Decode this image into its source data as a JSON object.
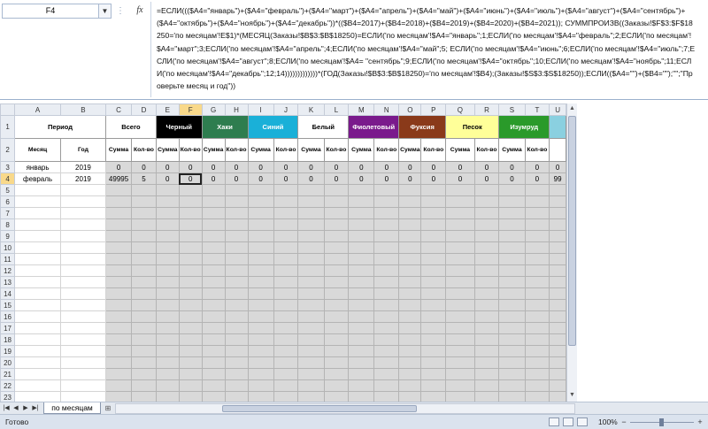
{
  "formula_bar": {
    "name_box": "F4",
    "fx_label": "fx",
    "formula": "=ЕСЛИ((($A4=\"январь\")+($A4=\"февраль\")+($A4=\"март\")+($A4=\"апрель\")+($A4=\"май\")+($A4=\"июнь\")+($A4=\"июль\")+($A4=\"август\")+($A4=\"сентябрь\")+($A4=\"октябрь\")+($A4=\"ноябрь\")+($A4=\"декабрь\"))*(($B4=2017)+($B4=2018)+($B4=2019)+($B4=2020)+($B4=2021)); СУММПРОИЗВ((Заказы!$F$3:$F$18250='по месяцам'!E$1)*(МЕСЯЦ(Заказы!$B$3:$B$18250)=ЕСЛИ('по месяцам'!$A4=\"январь\";1;ЕСЛИ('по месяцам'!$A4=\"февраль\";2;ЕСЛИ('по месяцам'!$A4=\"март\";3;ЕСЛИ('по месяцам'!$A4=\"апрель\";4;ЕСЛИ('по месяцам'!$A4=\"май\";5; ЕСЛИ('по месяцам'!$A4=\"июнь\";6;ЕСЛИ('по месяцам'!$A4=\"июль\";7;ЕСЛИ('по месяцам'!$A4=\"август\";8;ЕСЛИ('по месяцам'!$A4= \"сентябрь\";9;ЕСЛИ('по месяцам'!$A4=\"октябрь\";10;ЕСЛИ('по месяцам'!$A4=\"ноябрь\";11;ЕСЛИ('по месяцам'!$A4=\"декабрь\";12;14)))))))))))))*(ГОД(Заказы!$B$3:$B$18250)='по месяцам'!$B4);(Заказы!$S$3:$S$18250));ЕСЛИ(($A4=\"\")+($B4=\"\");\"\";\"Проверьте месяц и год\"))"
  },
  "columns": [
    "A",
    "B",
    "C",
    "D",
    "E",
    "F",
    "G",
    "H",
    "I",
    "J",
    "K",
    "L",
    "M",
    "N",
    "O",
    "P",
    "Q",
    "R",
    "S",
    "T",
    "U"
  ],
  "header_row1": {
    "period": "Период",
    "total": "Всего",
    "colors": [
      {
        "name": "Черный",
        "bg": "#000000",
        "fg": "#ffffff"
      },
      {
        "name": "Хаки",
        "bg": "#2e7d4f",
        "fg": "#ffffff"
      },
      {
        "name": "Синий",
        "bg": "#1ab0d8",
        "fg": "#ffffff"
      },
      {
        "name": "Белый",
        "bg": "#ffffff",
        "fg": "#000000"
      },
      {
        "name": "Фиолетовый",
        "bg": "#7a1a8c",
        "fg": "#ffffff"
      },
      {
        "name": "Фуксия",
        "bg": "#8a3a1a",
        "fg": "#ffffff"
      },
      {
        "name": "Песок",
        "bg": "#ffff99",
        "fg": "#000000"
      },
      {
        "name": "Изумруд",
        "bg": "#2a9a2a",
        "fg": "#ffffff"
      }
    ]
  },
  "header_row2": {
    "month": "Месяц",
    "year": "Год",
    "sum": "Сумма",
    "qty": "Кол-во"
  },
  "rows": [
    {
      "num": "3",
      "month": "январь",
      "year": "2019",
      "values": [
        "0",
        "0",
        "0",
        "0",
        "0",
        "0",
        "0",
        "0",
        "0",
        "0",
        "0",
        "0",
        "0",
        "0",
        "0",
        "0",
        "0",
        "0",
        "0"
      ]
    },
    {
      "num": "4",
      "month": "февраль",
      "year": "2019",
      "values": [
        "49995",
        "5",
        "0",
        "0",
        "0",
        "0",
        "0",
        "0",
        "0",
        "0",
        "0",
        "0",
        "0",
        "0",
        "0",
        "0",
        "0",
        "0",
        "99"
      ]
    }
  ],
  "empty_row_numbers": [
    "5",
    "6",
    "7",
    "8",
    "9",
    "10",
    "11",
    "12",
    "13",
    "14",
    "15",
    "16",
    "17",
    "18",
    "19",
    "20",
    "21",
    "22",
    "23"
  ],
  "sheet_tab": "по месяцам",
  "status": {
    "ready": "Готово",
    "zoom": "100%"
  }
}
